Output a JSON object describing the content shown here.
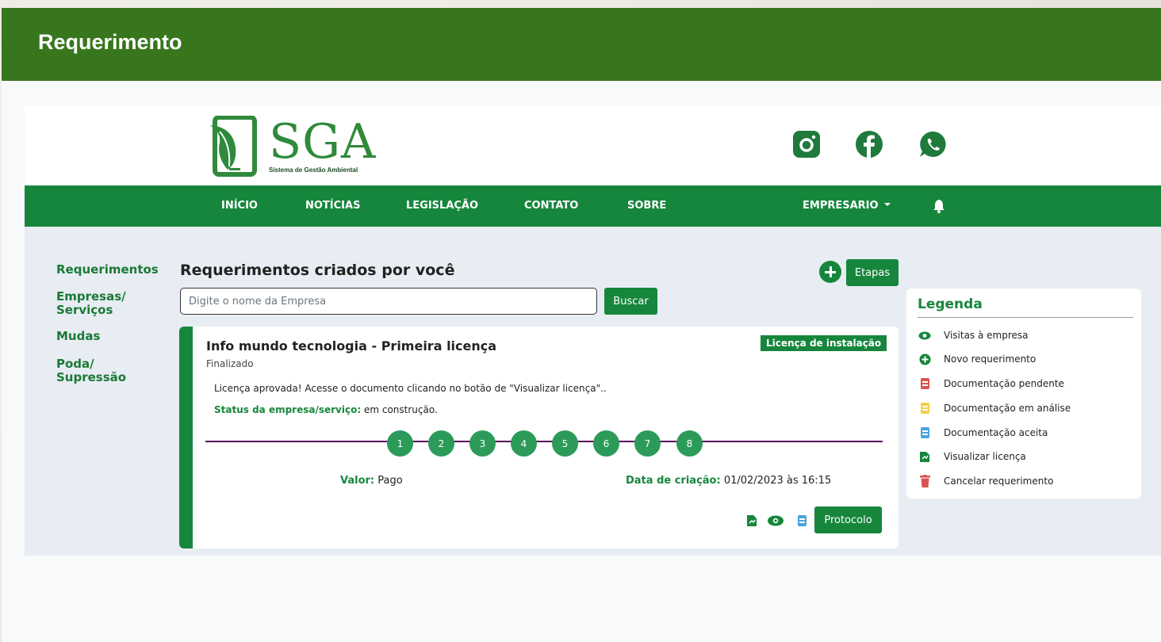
{
  "slide": {
    "title": "Requerimento"
  },
  "logo": {
    "letters": "SGA",
    "subtitle": "Sistema de Gestão Ambiental"
  },
  "social": {
    "icons": [
      "instagram-icon",
      "facebook-icon",
      "whatsapp-icon"
    ]
  },
  "nav": {
    "items": [
      "INÍCIO",
      "NOTÍCIAS",
      "LEGISLAÇÃO",
      "CONTATO",
      "SOBRE"
    ],
    "user_menu": "EMPRESARIO",
    "bell_icon": "bell-icon"
  },
  "sidebar": {
    "items": [
      {
        "line1": "Requerimentos",
        "line2": ""
      },
      {
        "line1": "Empresas/",
        "line2": "Serviços"
      },
      {
        "line1": "Mudas",
        "line2": ""
      },
      {
        "line1": "Poda/",
        "line2": "Supressão"
      }
    ]
  },
  "main": {
    "title": "Requerimentos criados por você",
    "add_icon": "plus-circle-icon",
    "steps_button": "Etapas",
    "search": {
      "placeholder": "Digite o nome da Empresa",
      "value": "",
      "button": "Buscar"
    },
    "card": {
      "title": "Info mundo tecnologia - Primeira licença",
      "badge": "Licença de instalação",
      "status": "Finalizado",
      "message": "Licença aprovada! Acesse o documento clicando no botão de \"Visualizar licença\"..",
      "company_status_label": "Status da empresa/serviço:",
      "company_status_value": " em construção.",
      "steps": [
        "1",
        "2",
        "3",
        "4",
        "5",
        "6",
        "7",
        "8"
      ],
      "valor_label": "Valor:",
      "valor_value": " Pago",
      "data_label": "Data de criação:",
      "data_value": " 01/02/2023 às 16:15",
      "protocol_button": "Protocolo",
      "action_icons": [
        "view-licence-icon",
        "eye-icon",
        "document-accepted-icon"
      ]
    }
  },
  "legend": {
    "title": "Legenda",
    "items": [
      {
        "label": "Visitas à empresa",
        "icon": "eye-icon",
        "color": "#16863c"
      },
      {
        "label": "Novo requerimento",
        "icon": "plus-circle-icon",
        "color": "#16863c"
      },
      {
        "label": "Documentação pendente",
        "icon": "document-icon",
        "color": "#d9534f"
      },
      {
        "label": "Documentação em análise",
        "icon": "document-icon",
        "color": "#f0d04b"
      },
      {
        "label": "Documentação aceita",
        "icon": "document-icon",
        "color": "#4aa3df"
      },
      {
        "label": "Visualizar licença",
        "icon": "licence-icon",
        "color": "#16863c"
      },
      {
        "label": "Cancelar requerimento",
        "icon": "trash-icon",
        "color": "#d9534f"
      }
    ]
  },
  "colors": {
    "brand_green": "#16863c",
    "header_green": "#38761d",
    "timeline": "#5b0a5b"
  }
}
